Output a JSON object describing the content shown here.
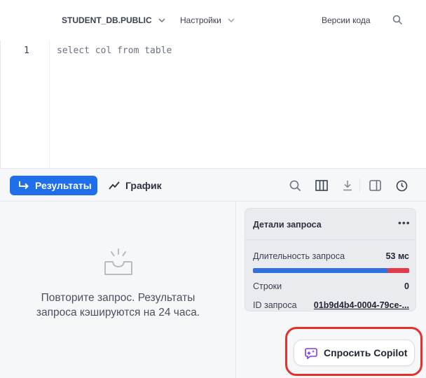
{
  "topbar": {
    "database": "STUDENT_DB.PUBLIC",
    "settings": "Настройки",
    "versions": "Версии кода",
    "icons": [
      "chevron-down-icon",
      "search-icon"
    ]
  },
  "editor": {
    "line_number": "1",
    "code": "select col from table"
  },
  "toolbar": {
    "results_label": "Результаты",
    "chart_label": "График",
    "accent": "#1f6feb",
    "icons": [
      "search-icon",
      "columns-icon",
      "download-icon",
      "split-pane-icon",
      "history-icon"
    ]
  },
  "results": {
    "empty_message": "Повторите запрос. Результаты запроса кэшируются на 24 часа."
  },
  "query_details": {
    "title": "Детали запроса",
    "more": "•••",
    "duration_label": "Длительность запроса",
    "duration_value": "53 мс",
    "rows_label": "Строки",
    "rows_value": "0",
    "id_label": "ID запроса",
    "id_value": "01b9d4b4-0004-79ce-...",
    "duration_bar": {
      "blue_fraction": 0.86,
      "red_fraction": 0.14,
      "blue_color": "#2f6fe0",
      "red_color": "#e23b4b"
    }
  },
  "copilot": {
    "label": "Спросить Copilot",
    "highlight_color": "#e5302e"
  }
}
